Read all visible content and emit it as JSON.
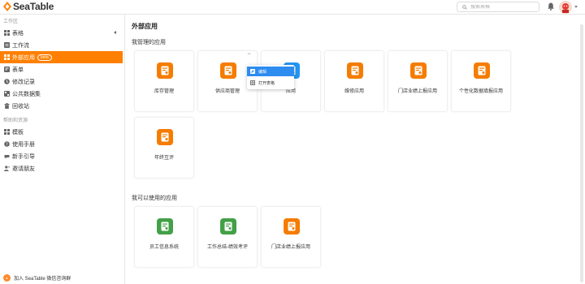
{
  "app": {
    "name": "SeaTable"
  },
  "header": {
    "search_placeholder": "搜索表格"
  },
  "sidebar": {
    "workspace_title": "工作区",
    "items": [
      {
        "label": "表格",
        "icon": "grid-icon"
      },
      {
        "label": "工作流",
        "icon": "list-icon"
      },
      {
        "label": "外部应用",
        "icon": "apps-icon",
        "badge": "beta",
        "active": true
      },
      {
        "label": "表单",
        "icon": "form-icon"
      },
      {
        "label": "修改记录",
        "icon": "history-icon"
      },
      {
        "label": "公共数据集",
        "icon": "dataset-icon"
      },
      {
        "label": "回收站",
        "icon": "trash-icon"
      }
    ],
    "help_title": "帮助和资源",
    "help_items": [
      {
        "label": "模板",
        "icon": "template-icon"
      },
      {
        "label": "使用手册",
        "icon": "manual-icon"
      },
      {
        "label": "新手引导",
        "icon": "guide-icon"
      },
      {
        "label": "邀请朋友",
        "icon": "invite-icon"
      }
    ],
    "join_label": "加入 SeaTable 微信咨询群"
  },
  "main": {
    "title": "外部应用",
    "my_apps_title": "我管理的应用",
    "my_apps": [
      {
        "label": "库存管理",
        "color": "#f57c00"
      },
      {
        "label": "供应商管理",
        "color": "#f57c00"
      },
      {
        "label": "应用",
        "color": "#2196f3"
      },
      {
        "label": "维修应用",
        "color": "#f57c00"
      },
      {
        "label": "门店业绩上报应用",
        "color": "#f57c00"
      },
      {
        "label": "个性化数据填报应用",
        "color": "#f57c00"
      },
      {
        "label": "年终互评",
        "color": "#f57c00"
      }
    ],
    "usable_apps_title": "我可以使用的应用",
    "usable_apps": [
      {
        "label": "员工信息系统",
        "color": "#43a047"
      },
      {
        "label": "工作总结-绩效考评",
        "color": "#43a047"
      },
      {
        "label": "门店业绩上报应用",
        "color": "#f57c00"
      }
    ],
    "more_label": "···",
    "context_menu": [
      {
        "label": "编辑",
        "icon": "edit-icon",
        "selected": true
      },
      {
        "label": "打开表格",
        "icon": "table-icon",
        "selected": false
      }
    ]
  }
}
